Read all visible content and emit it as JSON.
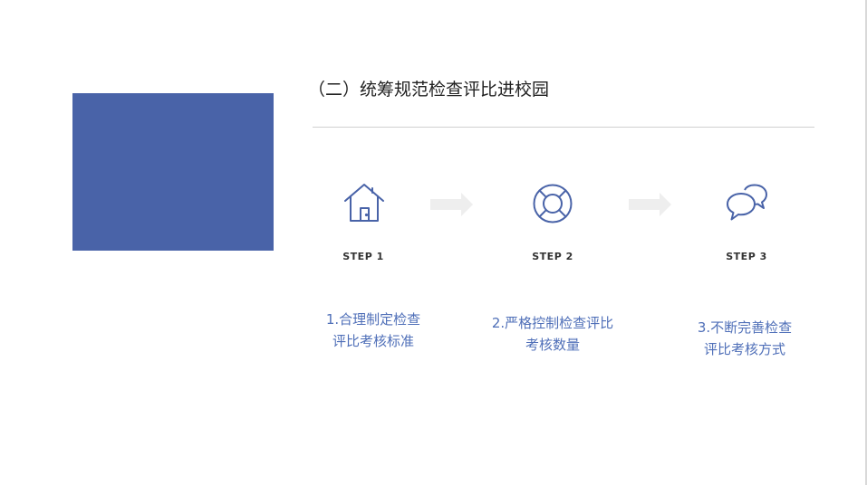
{
  "slide": {
    "title": "（二）统筹规范检查评比进校园",
    "steps": [
      {
        "label": "STEP 1",
        "icon": "house-icon",
        "desc_line1": "1.合理制定检查",
        "desc_line2": "评比考核标准"
      },
      {
        "label": "STEP 2",
        "icon": "lifebuoy-icon",
        "desc_line1": "2.严格控制检查评比",
        "desc_line2": "考核数量"
      },
      {
        "label": "STEP 3",
        "icon": "chat-bubbles-icon",
        "desc_line1": "3.不断完善检查",
        "desc_line2": "评比考核方式"
      }
    ]
  },
  "colors": {
    "accent_blue": "#4963a8",
    "text_blue": "#4f6fb8",
    "arrow_gray": "#eeeeee"
  }
}
